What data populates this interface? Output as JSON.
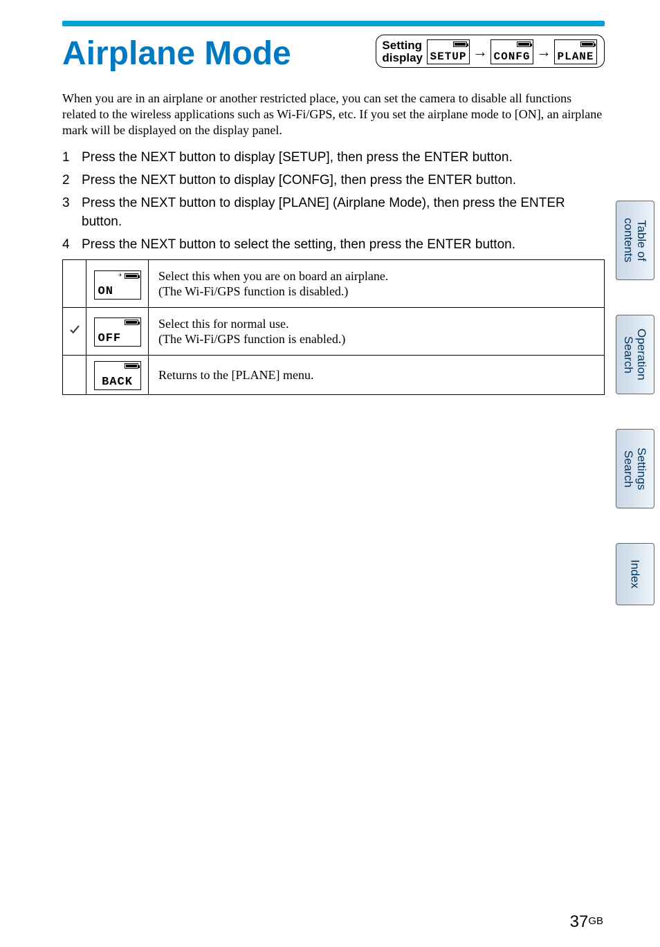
{
  "header": {
    "title": "Airplane Mode",
    "setting_display_label": "Setting\ndisplay",
    "breadcrumb": [
      "SETUP",
      "CONFG",
      "PLANE"
    ]
  },
  "intro": "When you are in an airplane or another restricted place, you can set the camera to disable all functions related to the wireless applications such as Wi-Fi/GPS, etc. If you set the airplane mode to [ON], an airplane mark will be displayed on the display panel.",
  "steps": [
    {
      "num": "1",
      "text": "Press the NEXT button to display [SETUP], then press the ENTER button."
    },
    {
      "num": "2",
      "text": "Press the NEXT button to display [CONFG], then press the ENTER button."
    },
    {
      "num": "3",
      "text": "Press the NEXT button to display [PLANE] (Airplane Mode), then press the ENTER button."
    },
    {
      "num": "4",
      "text": "Press the NEXT button to select the setting, then press the ENTER button."
    }
  ],
  "options": [
    {
      "check": false,
      "lcd": "ON",
      "show_plane_icon": true,
      "desc_line1": "Select this when you are on board an airplane.",
      "desc_line2": "(The Wi-Fi/GPS function is disabled.)"
    },
    {
      "check": true,
      "lcd": "OFF",
      "show_plane_icon": false,
      "desc_line1": "Select this for normal use.",
      "desc_line2": "(The Wi-Fi/GPS function is enabled.)"
    },
    {
      "check": false,
      "lcd": "BACK",
      "show_plane_icon": false,
      "desc_line1": "Returns to the [PLANE] menu.",
      "desc_line2": ""
    }
  ],
  "side_tabs": [
    {
      "label": "Table of\ncontents"
    },
    {
      "label": "Operation\nSearch"
    },
    {
      "label": "Settings\nSearch"
    },
    {
      "label": "Index"
    }
  ],
  "page_number": "37",
  "page_region": "GB",
  "glyphs": {
    "arrow": "→"
  }
}
